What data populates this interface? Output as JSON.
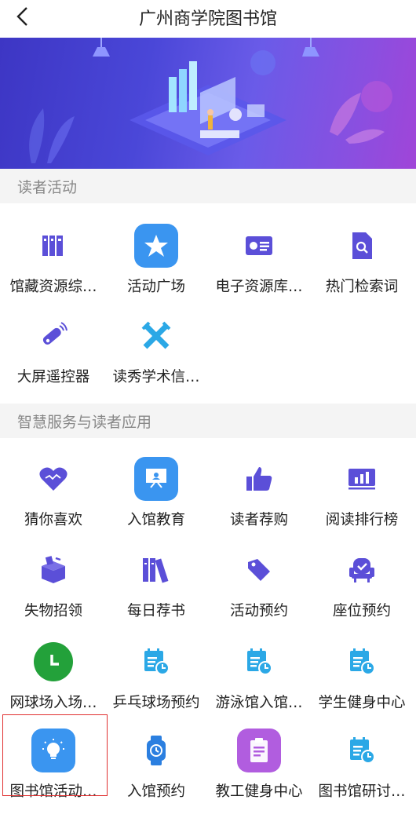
{
  "header": {
    "title": "广州商学院图书馆"
  },
  "colors": {
    "accent_blue": "#3a95f0",
    "icon_purple": "#5b4fd8",
    "icon_cyan": "#2ba8e6",
    "highlight_red": "#e03030"
  },
  "sections": [
    {
      "title": "读者活动",
      "items": [
        {
          "label": "馆藏资源综…",
          "icon": "bookshelf-icon"
        },
        {
          "label": "活动广场",
          "icon": "star-icon"
        },
        {
          "label": "电子资源库…",
          "icon": "id-card-icon"
        },
        {
          "label": "热门检索词",
          "icon": "search-doc-icon"
        },
        {
          "label": "大屏遥控器",
          "icon": "remote-icon"
        },
        {
          "label": "读秀学术信…",
          "icon": "cross-swords-icon"
        }
      ]
    },
    {
      "title": "智慧服务与读者应用",
      "items": [
        {
          "label": "猜你喜欢",
          "icon": "heart-icon"
        },
        {
          "label": "入馆教育",
          "icon": "presentation-icon"
        },
        {
          "label": "读者荐购",
          "icon": "thumbs-up-icon"
        },
        {
          "label": "阅读排行榜",
          "icon": "bar-chart-icon"
        },
        {
          "label": "失物招领",
          "icon": "box-icon"
        },
        {
          "label": "每日荐书",
          "icon": "books-icon"
        },
        {
          "label": "活动预约",
          "icon": "tag-icon"
        },
        {
          "label": "座位预约",
          "icon": "seat-icon"
        },
        {
          "label": "网球场入场…",
          "icon": "clock-icon"
        },
        {
          "label": "乒乓球场预约",
          "icon": "calendar-clock-icon"
        },
        {
          "label": "游泳馆入馆…",
          "icon": "calendar-clock-icon"
        },
        {
          "label": "学生健身中心",
          "icon": "calendar-clock-icon"
        },
        {
          "label": "图书馆活动…",
          "icon": "lightbulb-icon"
        },
        {
          "label": "入馆预约",
          "icon": "watch-icon"
        },
        {
          "label": "教工健身中心",
          "icon": "clipboard-icon"
        },
        {
          "label": "图书馆研讨…",
          "icon": "calendar-clock-icon"
        }
      ]
    }
  ]
}
